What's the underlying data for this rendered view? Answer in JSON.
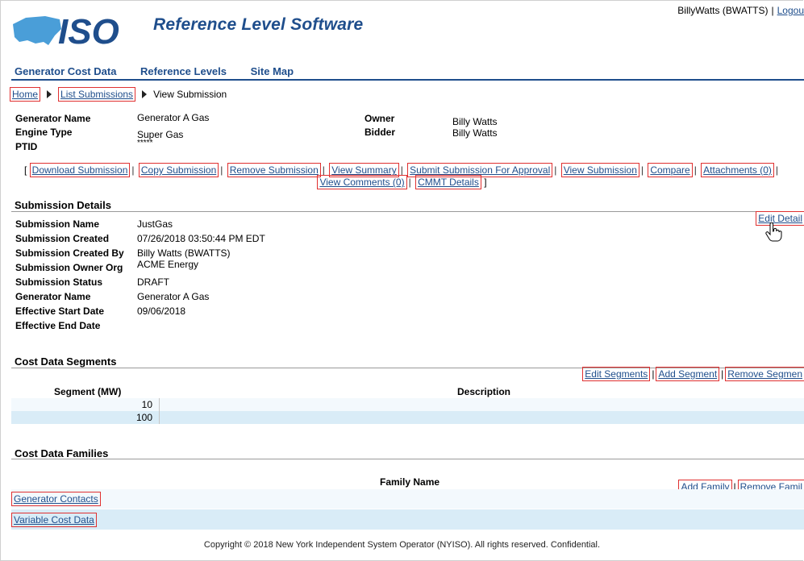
{
  "app": {
    "logo_text": "ISO",
    "title": "Reference Level Software"
  },
  "user": {
    "name": "BillyWatts (BWATTS)",
    "logout": "Logou"
  },
  "nav": [
    "Generator Cost Data",
    "Reference Levels",
    "Site Map"
  ],
  "breadcrumb": {
    "home": "Home",
    "list": "List Submissions",
    "current": "View Submission"
  },
  "header_fields": {
    "generator_name": {
      "label": "Generator Name",
      "value": "Generator A Gas"
    },
    "engine_type": {
      "label": "Engine Type",
      "value": "Super Gas"
    },
    "ptid": {
      "label": "PTID",
      "value": "*****"
    },
    "owner": {
      "label": "Owner",
      "value": "Billy Watts"
    },
    "bidder": {
      "label": "Bidder",
      "value": "Billy Watts"
    }
  },
  "actions": {
    "open_bracket": "[",
    "close_bracket": "]",
    "sep": "|",
    "download": "Download Submission",
    "copy": "Copy Submission",
    "remove": "Remove Submission",
    "summary": "View Summary",
    "submit": "Submit Submission For Approval",
    "view": "View Submission",
    "compare": "Compare",
    "attachments": "Attachments (0)",
    "comments": "View Comments (0)",
    "cmmt": "CMMT Details"
  },
  "details": {
    "title": "Submission Details",
    "edit": "Edit Detail",
    "rows": [
      {
        "label": "Submission Name",
        "value": "JustGas"
      },
      {
        "label": "Submission Created",
        "value": "07/26/2018 03:50:44 PM EDT"
      },
      {
        "label": "Submission Created By",
        "value": "Billy Watts (BWATTS)"
      },
      {
        "label": "Submission Owner Org",
        "value": "ACME Energy"
      },
      {
        "label": "Submission Status",
        "value": "DRAFT"
      },
      {
        "label": "Generator Name",
        "value": "Generator A Gas"
      },
      {
        "label": "Effective Start Date",
        "value": "09/06/2018"
      },
      {
        "label": "Effective End Date",
        "value": ""
      }
    ]
  },
  "segments": {
    "title": "Cost Data Segments",
    "edit": "Edit Segments",
    "add": "Add Segment",
    "remove": "Remove Segmen",
    "col_mw": "Segment (MW)",
    "col_desc": "Description",
    "rows": [
      "10",
      "100"
    ]
  },
  "families": {
    "title": "Cost Data Families",
    "add": "Add Family",
    "remove": "Remove Famil",
    "col_name": "Family Name",
    "rows": [
      "Generator Contacts",
      "Variable Cost Data"
    ]
  },
  "footer": "Copyright © 2018 New York Independent System Operator (NYISO). All rights reserved. Confidential."
}
